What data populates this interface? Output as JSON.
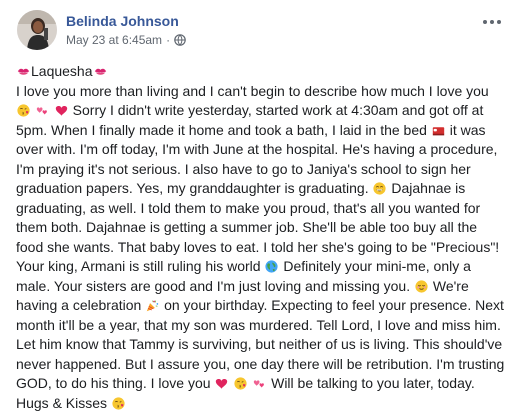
{
  "post": {
    "author": "Belinda Johnson",
    "timestamp": "May 23 at 6:45am",
    "separator": "·",
    "privacy_icon": "globe-icon",
    "more_icon": "ellipsis-icon",
    "greeting": "Laquesha",
    "body": {
      "s1": "I love you more than living and I can't begin to describe how much I love you",
      "s2": "Sorry I didn't write yesterday, started work at 4:30am and got off at 5pm. When I finally made it home and took a bath, I laid in the bed",
      "s3": "it was over with. I'm off today, I'm with June at the hospital. He's having a procedure, I'm praying it's not serious. I also have to go to Janiya's school to sign her graduation papers. Yes, my granddaughter is graduating.",
      "s4": "Dajahnae is graduating, as well. I told them to make you proud, that's all you wanted for them both. Dajahnae is getting a summer job. She'll be able too buy all the food she wants. That baby loves to eat. I told her she's going to be \"Precious\"! Your king, Armani is still ruling his world",
      "s5": "Definitely your mini-me, only a male. Your sisters are good and I'm just loving and missing you.",
      "s6": "We're having a celebration",
      "s7": "on your birthday. Expecting to feel your presence. Next month it'll be a year, that my son was murdered. Tell Lord, I love and miss him. Let him know that Tammy is surviving, but neither of us is living. This should've never happened. But I assure you, one day there will be retribution. I'm trusting GOD, to do his thing. I love you",
      "s8": "Will be talking to you later, today. Hugs & Kisses"
    },
    "emoji_names": [
      "kiss-mark-icon",
      "face-blowing-kiss-icon",
      "two-hearts-icon",
      "red-heart-icon",
      "bed-icon",
      "grinning-face-icon",
      "globe-earth-icon",
      "relieved-face-icon",
      "party-popper-icon"
    ],
    "colors": {
      "author_link": "#385898",
      "meta_text": "#606770",
      "body_text": "#1c1e21"
    }
  }
}
